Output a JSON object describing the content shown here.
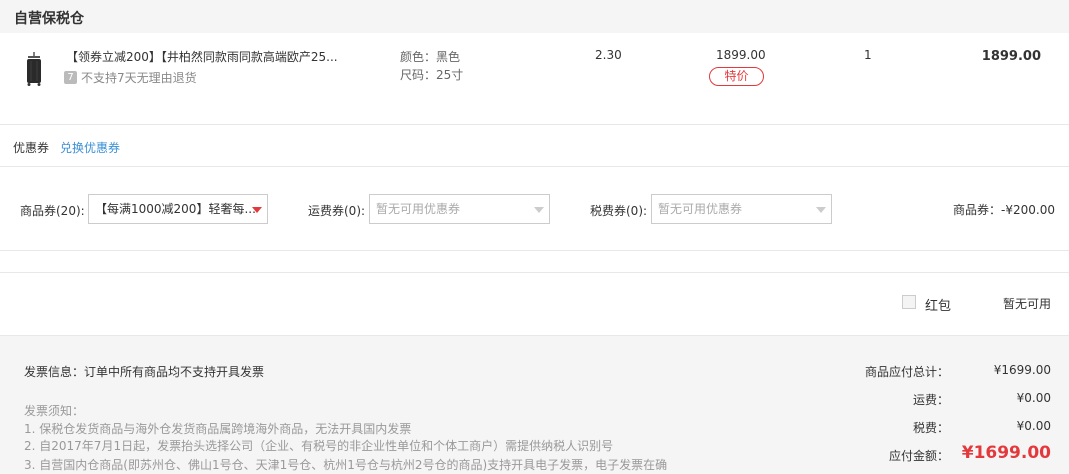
{
  "warehouse": {
    "title": "自营保税仓"
  },
  "product": {
    "icon": "suitcase-icon",
    "name": "【领券立减200】【井柏然同款雨同款高端欧产25...",
    "return_badge": "7",
    "return_note": "不支持7天无理由退货",
    "color": "颜色：黑色",
    "size": "尺码：25寸",
    "tax_rate": "2.30",
    "unit_price": "1899.00",
    "tag": "特价",
    "quantity": "1",
    "subtotal": "1899.00"
  },
  "coupons": {
    "label": "优惠券",
    "exchange_link": "兑换优惠券",
    "goods_label": "商品券(20):",
    "goods_selected": "【每满1000减200】轻奢每...",
    "shipping_label": "运费券(0):",
    "shipping_placeholder": "暂无可用优惠券",
    "tax_label": "税费券(0):",
    "tax_placeholder": "暂无可用优惠券",
    "goods_discount": "商品券：-¥200.00"
  },
  "redpack": {
    "label": "红包",
    "status": "暂无可用"
  },
  "footer": {
    "invoice_info": "发票信息：订单中所有商品均不支持开具发票",
    "notice_title": "发票须知：",
    "notice_1": "1. 保税仓发货商品与海外仓发货商品属跨境海外商品，无法开具国内发票",
    "notice_2": "2. 自2017年7月1日起，发票抬头选择公司（企业、有税号的非企业性单位和个体工商户）需提供纳税人识别号",
    "notice_3": "3. 自营国内仓商品(即苏州仓、佛山1号仓、天津1号仓、杭州1号仓与杭州2号仓的商品)支持开具电子发票，电子发票在确",
    "goods_total_label": "商品应付总计：",
    "goods_total": "¥1699.00",
    "shipping_label": "运费：",
    "shipping": "¥0.00",
    "tax_label": "税费：",
    "tax": "¥0.00",
    "payable_label": "应付金额：",
    "payable": "¥1699.00"
  },
  "colors": {
    "accent": "#e4393c",
    "link": "#3b8fd6"
  }
}
